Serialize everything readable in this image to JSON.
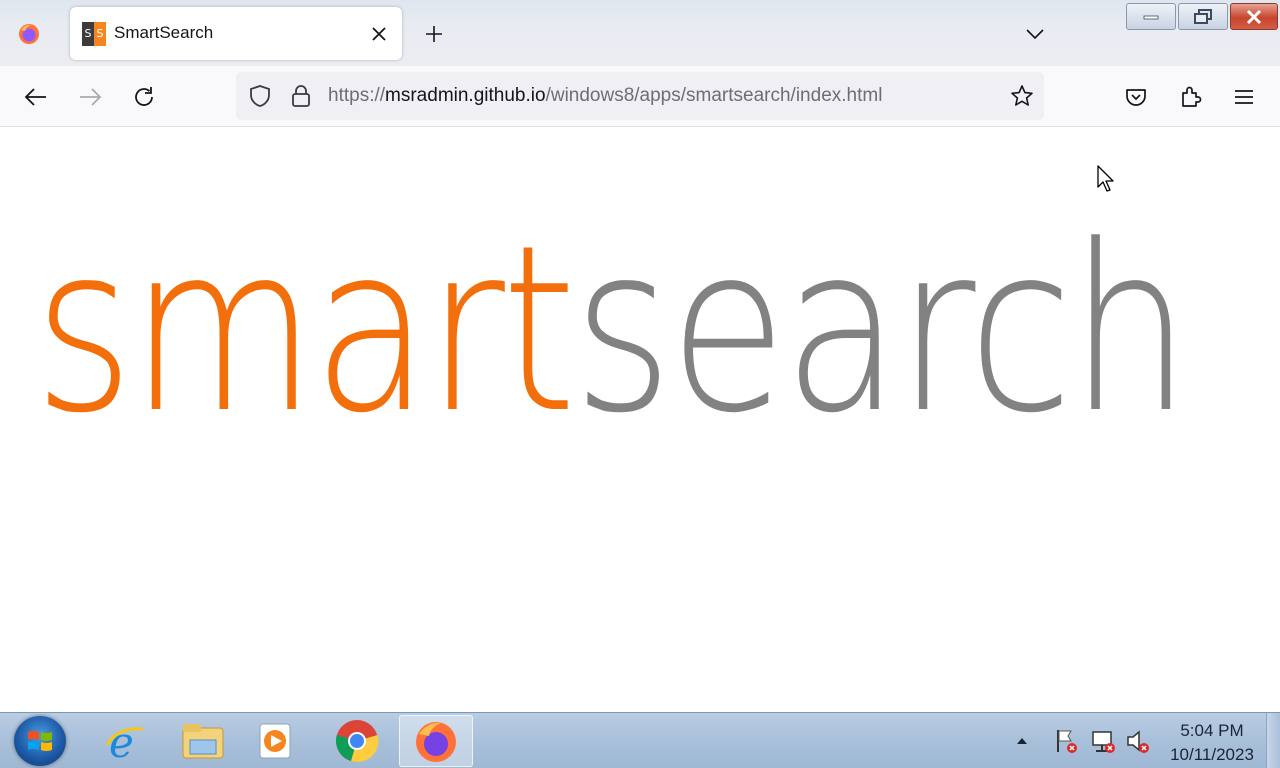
{
  "browser": {
    "tab": {
      "title": "SmartSearch",
      "favicon_letters": [
        "S",
        "S"
      ]
    },
    "url": {
      "scheme": "https://",
      "host": "msradmin.github.io",
      "path": "/windows8/apps/smartsearch/index.html"
    }
  },
  "page": {
    "logo": {
      "part1": "smart",
      "part2": "search"
    }
  },
  "colors": {
    "logo_orange": "#f26f0b",
    "logo_gray": "#828282"
  },
  "taskbar": {
    "apps": [
      "internet-explorer-icon",
      "file-explorer-icon",
      "media-player-icon",
      "chrome-icon",
      "firefox-icon"
    ],
    "clock": {
      "time": "5:04 PM",
      "date": "10/11/2023"
    }
  }
}
